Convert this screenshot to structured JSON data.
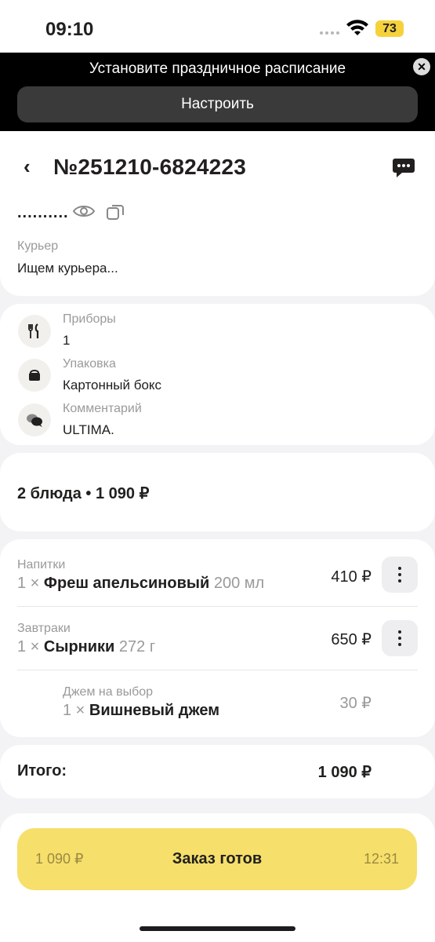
{
  "status_bar": {
    "time": "09:10",
    "battery": "73"
  },
  "banner": {
    "text": "Установите праздничное расписание",
    "button_label": "Настроить",
    "close_icon": "close-icon"
  },
  "header": {
    "title": "№251210-6824223",
    "back_icon": "chevron-left-icon",
    "chat_icon": "chat-icon"
  },
  "courier": {
    "masked": "..........",
    "label": "Курьер",
    "value": "Ищем курьера..."
  },
  "details": [
    {
      "icon": "cutlery-icon",
      "label": "Приборы",
      "value": "1"
    },
    {
      "icon": "package-icon",
      "label": "Упаковка",
      "value": "Картонный бокс"
    },
    {
      "icon": "comment-icon",
      "label": "Комментарий",
      "value": "ULTIMA."
    }
  ],
  "summary": {
    "text": "2 блюда • 1 090 ₽"
  },
  "items": [
    {
      "category": "Напитки",
      "qty": "1 ×",
      "name": "Фреш апельсиновый",
      "amount": "200 мл",
      "price": "410 ₽"
    },
    {
      "category": "Завтраки",
      "qty": "1 ×",
      "name": "Сырники",
      "amount": "272 г",
      "price": "650 ₽"
    },
    {
      "category": "Джем на выбор",
      "qty": "1 ×",
      "name": "Вишневый джем",
      "amount": "",
      "price": "30 ₽"
    }
  ],
  "total": {
    "label": "Итого:",
    "value": "1 090 ₽"
  },
  "ready_button": {
    "price": "1 090 ₽",
    "label": "Заказ готов",
    "time": "12:31"
  },
  "colors": {
    "accent": "#f6df6b",
    "battery": "#f5d23c",
    "banner_bg": "#000000"
  }
}
